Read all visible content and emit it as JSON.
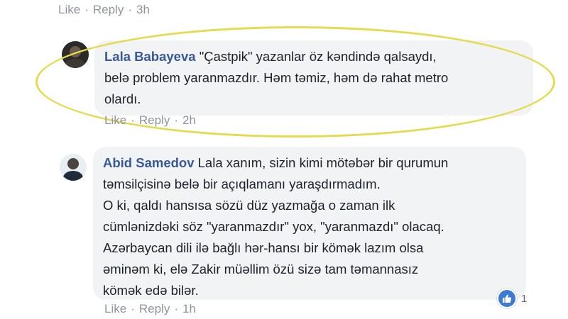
{
  "top_meta": {
    "like": "Like",
    "reply": "Reply",
    "time": "3h"
  },
  "comments": [
    {
      "author": "Lala Babayeva",
      "lines": [
        "\"Çastpik\" yazanlar öz kəndində qalsaydı,",
        "belə problem yaranmazdır. Həm təmiz, həm də rahat metro",
        "olardı."
      ],
      "like": "Like",
      "reply": "Reply",
      "time": "2h"
    },
    {
      "author": "Abid Samedov",
      "lines": [
        "Lala xanım, sizin kimi mötəbər bir qurumun",
        "təmsilçisinə belə bir açıqlamanı yaraşdırmadım.",
        "O ki, qaldı hansısa sözü düz yazmağa o zaman ilk",
        "cümlənizdəki söz \"yaranmazdır\" yox, \"yaranmazdı\" olacaq.",
        "Azərbaycan dili ilə bağlı hər-hansı bir kömək lazım olsa",
        "əminəm ki, elə Zakir müəllim özü sizə tam təmannasız",
        "kömək edə bilər."
      ],
      "reaction_count": "1",
      "like": "Like",
      "reply": "Reply",
      "time": "1h"
    }
  ],
  "icons": {
    "reaction": "thumbs-up-icon"
  },
  "colors": {
    "author": "#385898",
    "highlight": "#e3dc52",
    "bubble": "#f2f3f5"
  }
}
